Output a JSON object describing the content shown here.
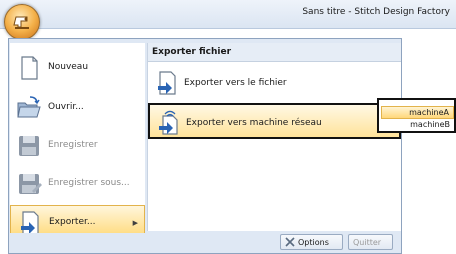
{
  "window": {
    "title": "Sans titre - Stitch Design Factory"
  },
  "left_menu": {
    "items": [
      {
        "label": "Nouveau",
        "icon": "new-document-icon",
        "state": "normal"
      },
      {
        "label": "Ouvrir...",
        "icon": "open-folder-icon",
        "state": "normal"
      },
      {
        "label": "Enregistrer",
        "icon": "save-floppy-icon",
        "state": "disabled"
      },
      {
        "label": "Enregistrer sous...",
        "icon": "save-as-floppy-icon",
        "state": "disabled"
      },
      {
        "label": "Exporter...",
        "icon": "export-icon",
        "state": "active"
      }
    ]
  },
  "export_pane": {
    "header": "Exporter fichier",
    "items": [
      {
        "label": "Exporter vers le fichier",
        "icon": "export-file-icon"
      },
      {
        "label": "Exporter vers machine réseau",
        "icon": "export-network-icon",
        "state": "highlighted"
      }
    ]
  },
  "machine_submenu": {
    "items": [
      {
        "label": "machineA",
        "state": "selected"
      },
      {
        "label": "machineB"
      }
    ]
  },
  "bottom_bar": {
    "options_label": "Options",
    "quit_label": "Quitter"
  },
  "colors": {
    "menu_background": "#dfe8f4",
    "highlight": "#ffd977",
    "border_dark": "#111111"
  }
}
